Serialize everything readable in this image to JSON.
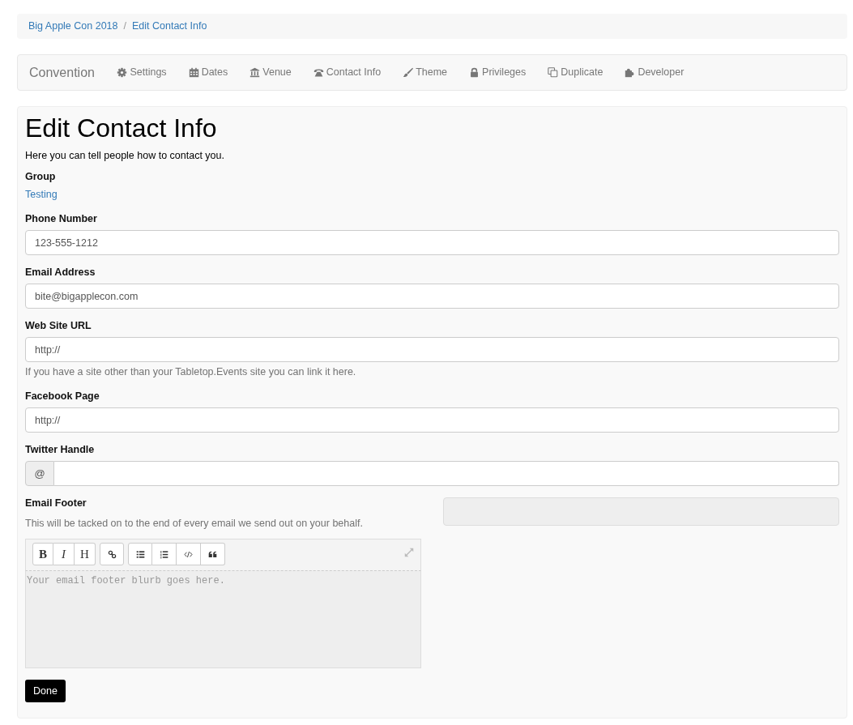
{
  "breadcrumb": {
    "items": [
      {
        "label": "Big Apple Con 2018"
      },
      {
        "label": "Edit Contact Info"
      }
    ],
    "separator": "/"
  },
  "navbar": {
    "brand": "Convention",
    "items": [
      {
        "label": "Settings"
      },
      {
        "label": "Dates"
      },
      {
        "label": "Venue"
      },
      {
        "label": "Contact Info"
      },
      {
        "label": "Theme"
      },
      {
        "label": "Privileges"
      },
      {
        "label": "Duplicate"
      },
      {
        "label": "Developer"
      }
    ]
  },
  "page": {
    "title": "Edit Contact Info",
    "intro": "Here you can tell people how to contact you.",
    "group": {
      "label": "Group",
      "value": "Testing"
    },
    "fields": [
      {
        "kind": "text",
        "label": "Phone Number",
        "value": "123-555-1212"
      },
      {
        "kind": "text",
        "label": "Email Address",
        "value": "bite@bigapplecon.com"
      },
      {
        "kind": "text",
        "label": "Web Site URL",
        "value": "http://",
        "help": "If you have a site other than your Tabletop.Events site you can link it here."
      },
      {
        "kind": "text",
        "label": "Facebook Page",
        "value": "http://"
      },
      {
        "kind": "addon",
        "label": "Twitter Handle",
        "addon": "@"
      }
    ],
    "email_footer": {
      "label": "Email Footer",
      "help": "This will be tacked on to the end of every email we send out on your behalf.",
      "toolbar": [
        [
          {
            "kind": "bold",
            "label": "B"
          },
          {
            "kind": "italic",
            "label": "I"
          },
          {
            "kind": "heading",
            "label": "H"
          }
        ],
        [
          {
            "kind": "link"
          }
        ],
        [
          {
            "kind": "bullet-list"
          },
          {
            "kind": "numbered-list"
          },
          {
            "kind": "code"
          },
          {
            "kind": "quote"
          }
        ]
      ],
      "placeholder": "Your email footer blurb goes here."
    },
    "submit": {
      "label": "Done"
    }
  }
}
